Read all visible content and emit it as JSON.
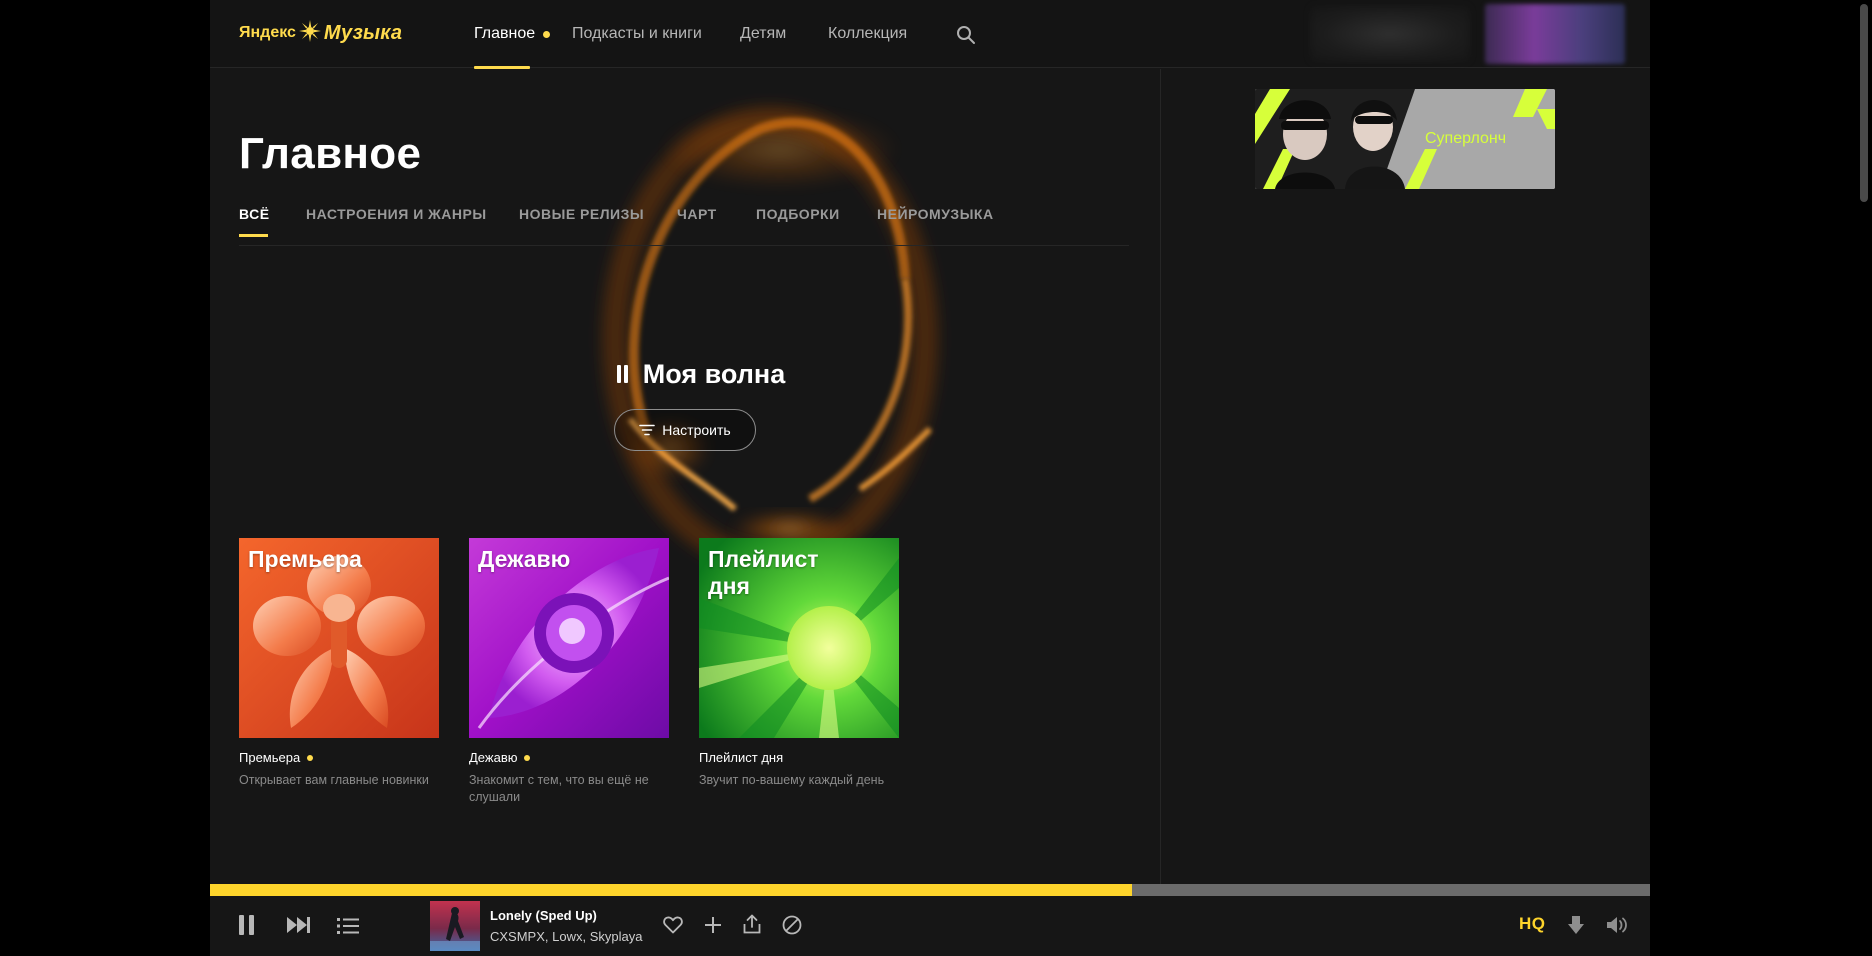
{
  "brand": {
    "logo_left": "Яндекс",
    "logo_right": "Музыка"
  },
  "header": {
    "nav": [
      {
        "label": "Главное",
        "active": true,
        "dot": true
      },
      {
        "label": "Подкасты и книги"
      },
      {
        "label": "Детям"
      },
      {
        "label": "Коллекция"
      }
    ],
    "search_icon": "search-icon"
  },
  "main": {
    "title": "Главное",
    "tabs": [
      "ВСЁ",
      "НАСТРОЕНИЯ И ЖАНРЫ",
      "НОВЫЕ РЕЛИЗЫ",
      "ЧАРТ",
      "ПОДБОРКИ",
      "НЕЙРОМУЗЫКА"
    ],
    "active_tab": "ВСЁ",
    "wave": {
      "title": "Моя волна",
      "tune_label": "Настроить"
    },
    "cards": [
      {
        "cover_text": "Премьера",
        "title": "Премьера",
        "new": true,
        "description": "Открывает вам главные новинки"
      },
      {
        "cover_text": "Дежавю",
        "title": "Дежавю",
        "new": true,
        "description": "Знакомит с тем, что вы ещё не слушали"
      },
      {
        "cover_text": "Плейлист дня",
        "title": "Плейлист дня",
        "new": false,
        "description": "Звучит по-вашему каждый день"
      }
    ]
  },
  "sidebar": {
    "promo_text": "Суперлонч"
  },
  "player": {
    "progress": 0.64,
    "track_title": "Lonely (Sped Up)",
    "artists": "CXSMPX, Lowx, Skyplaya",
    "quality_label": "HQ",
    "icons": [
      "pause-icon",
      "next-icon",
      "queue-icon",
      "heart-icon",
      "plus-icon",
      "share-icon",
      "block-icon",
      "download-icon",
      "volume-icon"
    ]
  },
  "colors": {
    "accent": "#ffdb4d",
    "progress": "#fed42b",
    "background": "#161616",
    "promo_lime": "#d7ff3a"
  }
}
